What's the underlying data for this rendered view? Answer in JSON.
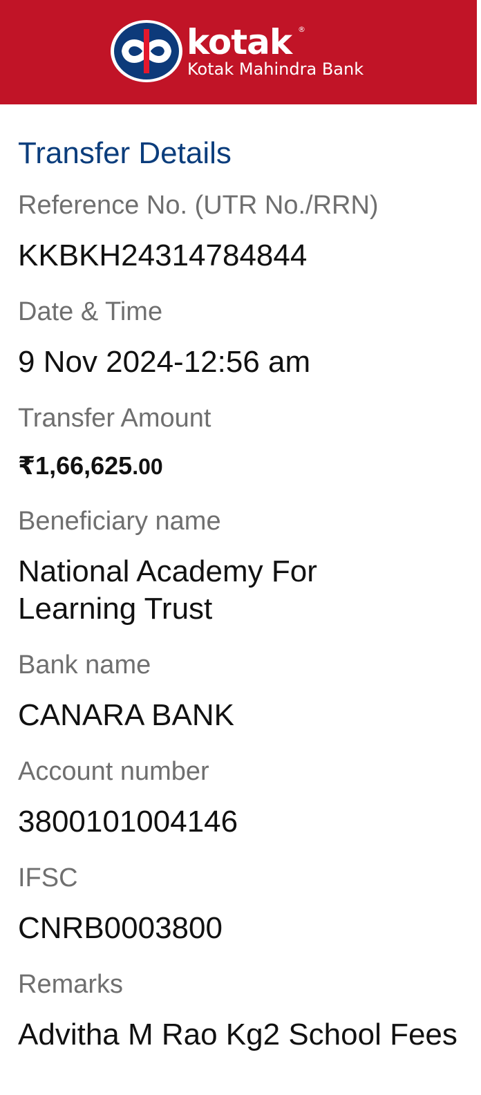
{
  "header": {
    "brand_name": "kotak",
    "registered_mark": "®",
    "brand_subtitle": "Kotak Mahindra Bank",
    "brand_color": "#c11427",
    "logo_icon": "kotak-infinity-logo-icon"
  },
  "transfer": {
    "title": "Transfer Details",
    "title_color": "#0b3d7c",
    "fields": [
      {
        "label": "Reference No. (UTR No./RRN)",
        "value": "KKBKH24314784844"
      },
      {
        "label": "Date & Time",
        "value": "9 Nov 2024-12:56 am"
      },
      {
        "label": "Transfer Amount",
        "value": "₹1,66,625",
        "value_decimal": ".00"
      },
      {
        "label": "Beneficiary name",
        "value": "National Academy For Learning Trust"
      },
      {
        "label": "Bank name",
        "value": "CANARA BANK"
      },
      {
        "label": "Account number",
        "value": "3800101004146"
      },
      {
        "label": "IFSC",
        "value": "CNRB0003800"
      },
      {
        "label": "Remarks",
        "value": "Advitha M Rao Kg2 School Fees"
      }
    ]
  }
}
